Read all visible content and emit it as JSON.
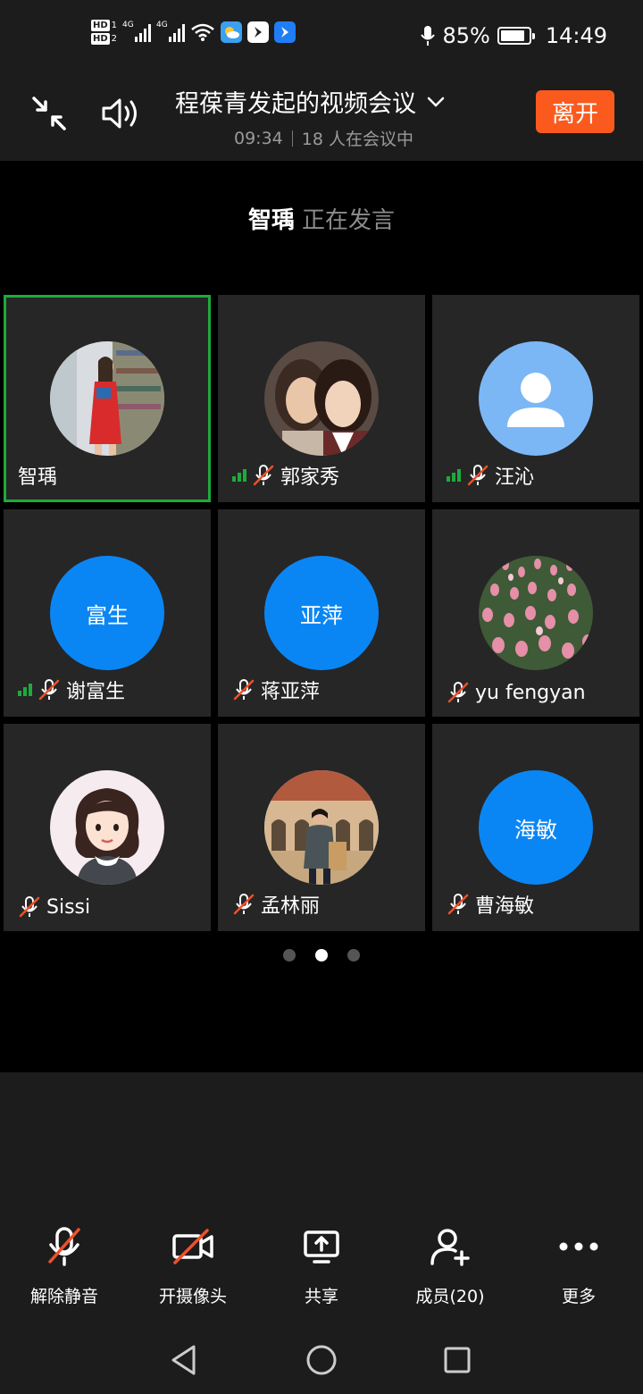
{
  "status_bar": {
    "hd1": "HD",
    "hd1_num": "1",
    "hd2": "HD",
    "hd2_num": "2",
    "net1": "4G",
    "net2": "4G",
    "battery_percent": "85%",
    "battery_level": 0.85,
    "time": "14:49",
    "icons": [
      "wifi-icon",
      "weather-icon",
      "app-icon-1",
      "app-icon-2",
      "microphone-icon"
    ]
  },
  "header": {
    "title": "程葆青发起的视频会议",
    "duration": "09:34",
    "participants": "18 人在会议中",
    "leave_label": "离开"
  },
  "speaker": {
    "name": "智瑀",
    "status": "正在发言"
  },
  "tiles": [
    {
      "name": "智瑀",
      "avatar_type": "photo",
      "photo": "woman-red-dress-library",
      "active": true,
      "muted": false,
      "signal": false
    },
    {
      "name": "郭家秀",
      "avatar_type": "photo",
      "photo": "two-women-selfie",
      "active": false,
      "muted": true,
      "signal": true
    },
    {
      "name": "汪沁",
      "avatar_type": "default",
      "active": false,
      "muted": true,
      "signal": true
    },
    {
      "name": "谢富生",
      "avatar_type": "initials",
      "initials": "富生",
      "active": false,
      "muted": true,
      "signal": true
    },
    {
      "name": "蒋亚萍",
      "avatar_type": "initials",
      "initials": "亚萍",
      "active": false,
      "muted": true,
      "signal": false
    },
    {
      "name": "yu fengyan",
      "avatar_type": "photo",
      "photo": "tulip-field",
      "active": false,
      "muted": true,
      "signal": false
    },
    {
      "name": "Sissi",
      "avatar_type": "photo",
      "photo": "cartoon-girl",
      "active": false,
      "muted": true,
      "signal": false
    },
    {
      "name": "孟林丽",
      "avatar_type": "photo",
      "photo": "woman-in-front-of-building",
      "active": false,
      "muted": true,
      "signal": false
    },
    {
      "name": "曹海敏",
      "avatar_type": "initials",
      "initials": "海敏",
      "active": false,
      "muted": true,
      "signal": false
    }
  ],
  "pager": {
    "pages": 3,
    "current": 2
  },
  "toolbar": {
    "unmute": "解除静音",
    "camera": "开摄像头",
    "share": "共享",
    "members": "成员(20)",
    "more": "更多"
  },
  "colors": {
    "accent_green": "#1dab3c",
    "leave_orange": "#fa5a1e",
    "avatar_blue": "#0a86f4",
    "mute_red": "#f0502a"
  }
}
